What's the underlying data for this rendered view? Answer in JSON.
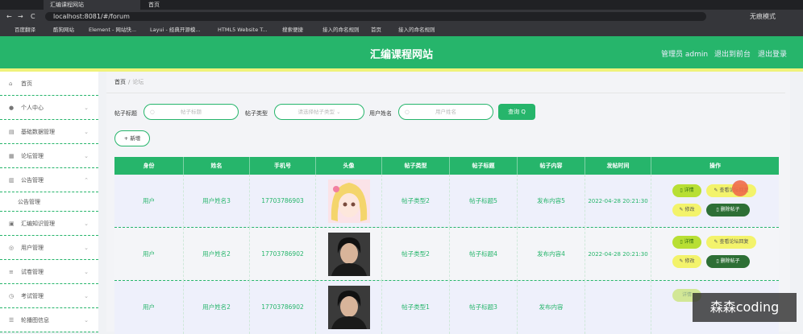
{
  "browser": {
    "tabs": [
      "汇编课程网站",
      "首页"
    ],
    "url": "localhost:8081/#/forum",
    "profile": "无痕模式",
    "bookmarks": [
      "百度翻译",
      "酷狗网站",
      "Element - 网站快...",
      "Layui - 经典开源模...",
      "HTML5 Website T...",
      "搜索便捷",
      "接入的命名规则",
      "首页",
      "接入的命名规则"
    ]
  },
  "header": {
    "title": "汇编课程网站",
    "role": "管理员 admin",
    "back_link": "退出到前台",
    "logout_link": "退出登录"
  },
  "sidebar": {
    "items": [
      {
        "label": "首页",
        "icon": "home-icon"
      },
      {
        "label": "个人中心",
        "icon": "user-icon"
      },
      {
        "label": "基础数据管理",
        "icon": "database-icon"
      },
      {
        "label": "论坛管理",
        "icon": "forum-icon"
      },
      {
        "label": "公告管理",
        "icon": "notice-icon"
      },
      {
        "label": "公告管理",
        "icon": ""
      },
      {
        "label": "汇编知识管理",
        "icon": "book-icon"
      },
      {
        "label": "用户管理",
        "icon": "users-icon"
      },
      {
        "label": "试卷管理",
        "icon": "list-icon"
      },
      {
        "label": "考试管理",
        "icon": "clock-icon"
      },
      {
        "label": "轮播图信息",
        "icon": "slider-icon"
      }
    ]
  },
  "breadcrumb": {
    "home": "首页",
    "current": "论坛"
  },
  "search": {
    "title_label": "帖子标题",
    "title_placeholder": "帖子标题",
    "type_label": "帖子类型",
    "type_placeholder": "请选择帖子类型",
    "user_label": "用户姓名",
    "user_placeholder": "用户姓名",
    "search_button": "查询",
    "add_button": "+ 新增"
  },
  "table": {
    "columns": [
      "身份",
      "姓名",
      "手机号",
      "头像",
      "帖子类型",
      "帖子标题",
      "帖子内容",
      "发帖时间",
      "操作"
    ],
    "rows": [
      {
        "identity": "用户",
        "name": "用户姓名3",
        "phone": "17703786903",
        "type": "帖子类型2",
        "title": "帖子标题5",
        "content": "发布内容5",
        "time": "2022-04-28 20:21:30"
      },
      {
        "identity": "用户",
        "name": "用户姓名2",
        "phone": "17703786902",
        "type": "帖子类型2",
        "title": "帖子标题4",
        "content": "发布内容4",
        "time": "2022-04-28 20:21:30"
      },
      {
        "identity": "用户",
        "name": "用户姓名2",
        "phone": "17703786902",
        "type": "帖子类型1",
        "title": "帖子标题3",
        "content": "发布内容",
        "time": ""
      }
    ],
    "actions": {
      "detail": "详情",
      "view_reply": "查看论坛回复",
      "edit": "修改",
      "delete": "删除帖子"
    }
  },
  "watermark": "森森coding",
  "colors": {
    "brand": "#26b56b",
    "strip": "#eff27a",
    "danger": "#2d6f35"
  }
}
